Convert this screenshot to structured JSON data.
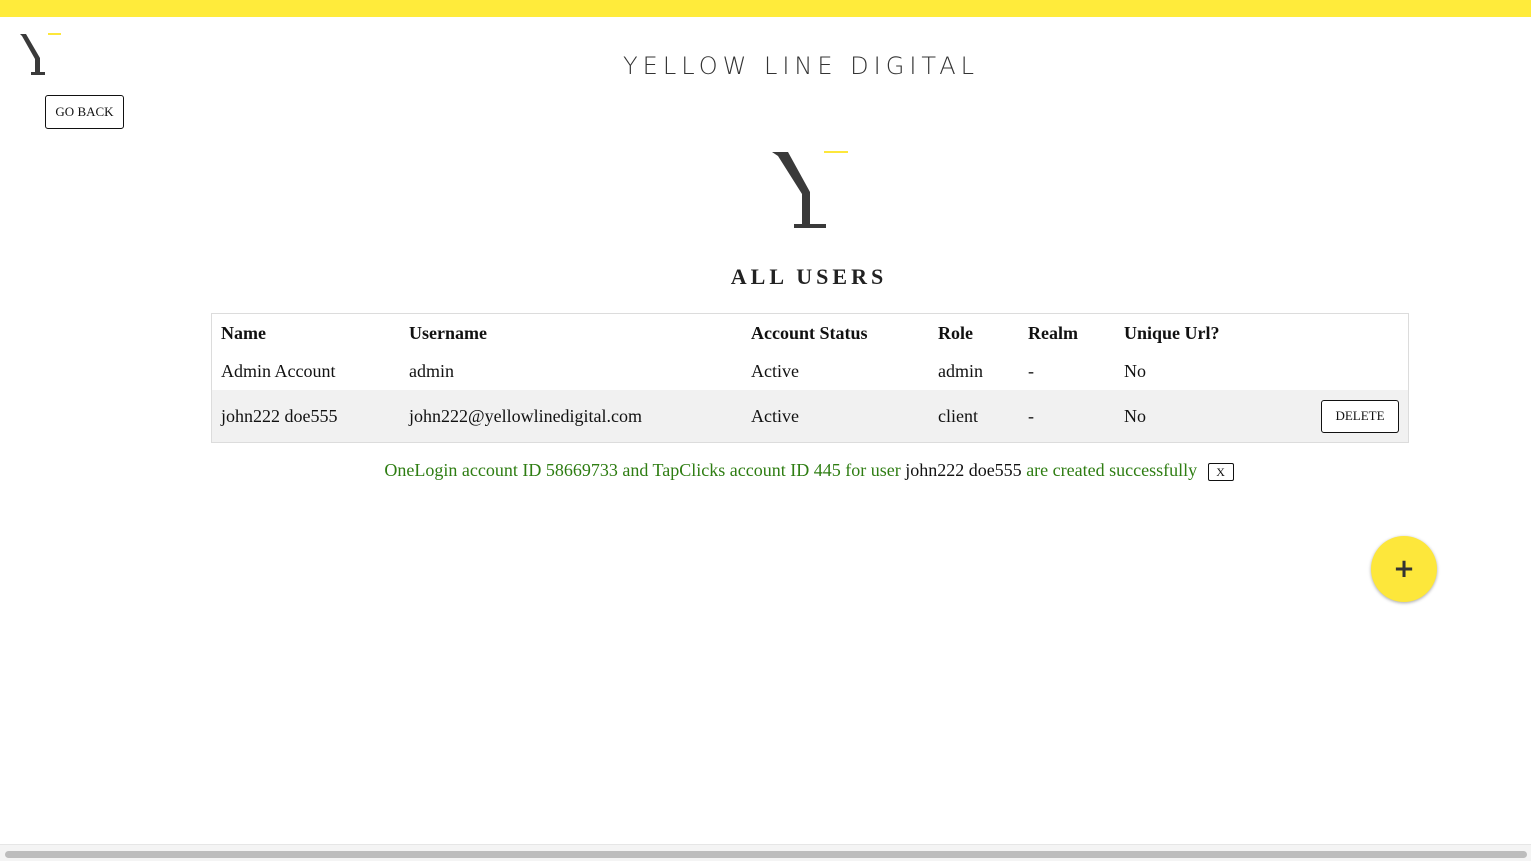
{
  "brand": {
    "title": "YELLOW LINE DIGITAL",
    "accent_color": "#ffeb3b"
  },
  "nav": {
    "go_back_label": "GO BACK"
  },
  "page": {
    "title": "ALL USERS"
  },
  "table": {
    "headers": {
      "name": "Name",
      "username": "Username",
      "status": "Account Status",
      "role": "Role",
      "realm": "Realm",
      "unique_url": "Unique Url?"
    },
    "rows": [
      {
        "name": "Admin Account",
        "username": "admin",
        "status": "Active",
        "role": "admin",
        "realm": "-",
        "unique_url": "No"
      },
      {
        "name": "john222 doe555",
        "username": "john222@yellowlinedigital.com",
        "status": "Active",
        "role": "client",
        "realm": "-",
        "unique_url": "No",
        "action_label": "DELETE"
      }
    ]
  },
  "notification": {
    "prefix": "OneLogin account ID 58669733 and TapClicks account ID 445 for user",
    "user": "john222 doe555",
    "suffix": "are created successfully",
    "close_label": "X",
    "color": "#2e7d12"
  },
  "fab": {
    "label": "+",
    "icon": "plus-icon",
    "color": "#fde73b"
  }
}
